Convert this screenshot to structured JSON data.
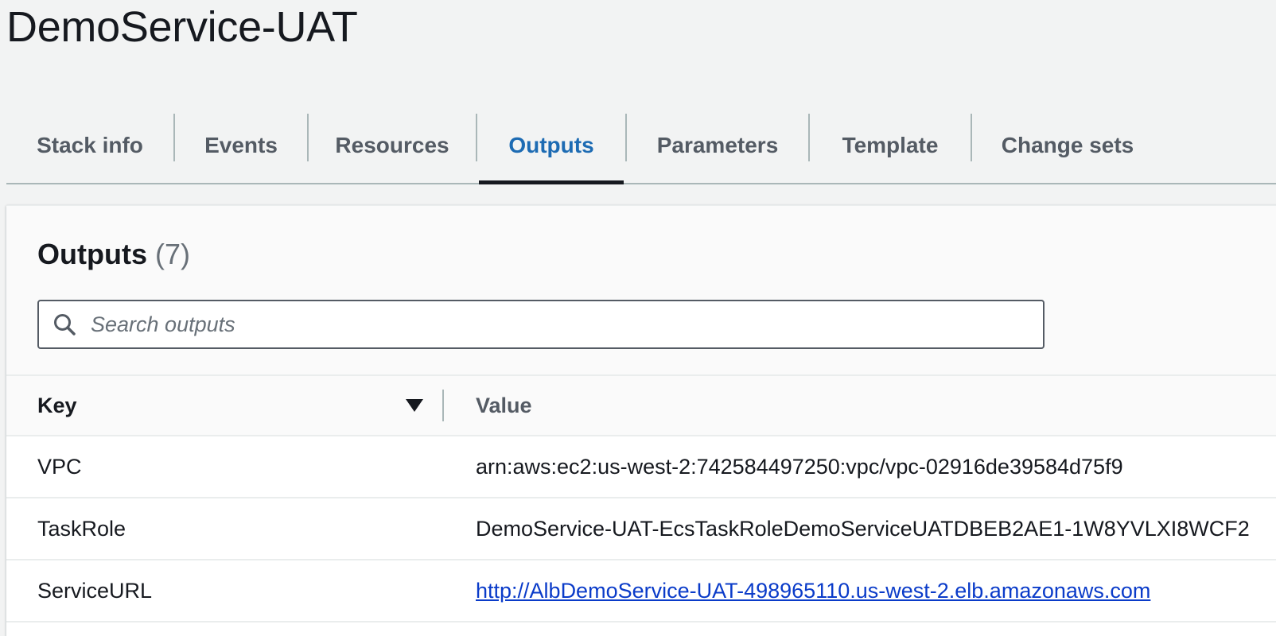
{
  "header": {
    "title": "DemoService-UAT"
  },
  "tabs": [
    {
      "label": "Stack info",
      "active": false
    },
    {
      "label": "Events",
      "active": false
    },
    {
      "label": "Resources",
      "active": false
    },
    {
      "label": "Outputs",
      "active": true
    },
    {
      "label": "Parameters",
      "active": false
    },
    {
      "label": "Template",
      "active": false
    },
    {
      "label": "Change sets",
      "active": false
    }
  ],
  "outputs_panel": {
    "title": "Outputs",
    "count": "(7)",
    "search": {
      "placeholder": "Search outputs",
      "value": "",
      "icon": "search-icon"
    },
    "columns": {
      "key": "Key",
      "value": "Value",
      "sort_icon": "caret-down-icon"
    },
    "rows": [
      {
        "key": "VPC",
        "value": "arn:aws:ec2:us-west-2:742584497250:vpc/vpc-02916de39584d75f9",
        "is_link": false
      },
      {
        "key": "TaskRole",
        "value": "DemoService-UAT-EcsTaskRoleDemoServiceUATDBEB2AE1-1W8YVLXI8WCF2",
        "is_link": false
      },
      {
        "key": "ServiceURL",
        "value": "http://AlbDemoService-UAT-498965110.us-west-2.elb.amazonaws.com",
        "is_link": true
      }
    ]
  },
  "colors": {
    "active_tab": "#1d6bb3",
    "link": "#0a3bc9",
    "background": "#f2f3f3"
  }
}
